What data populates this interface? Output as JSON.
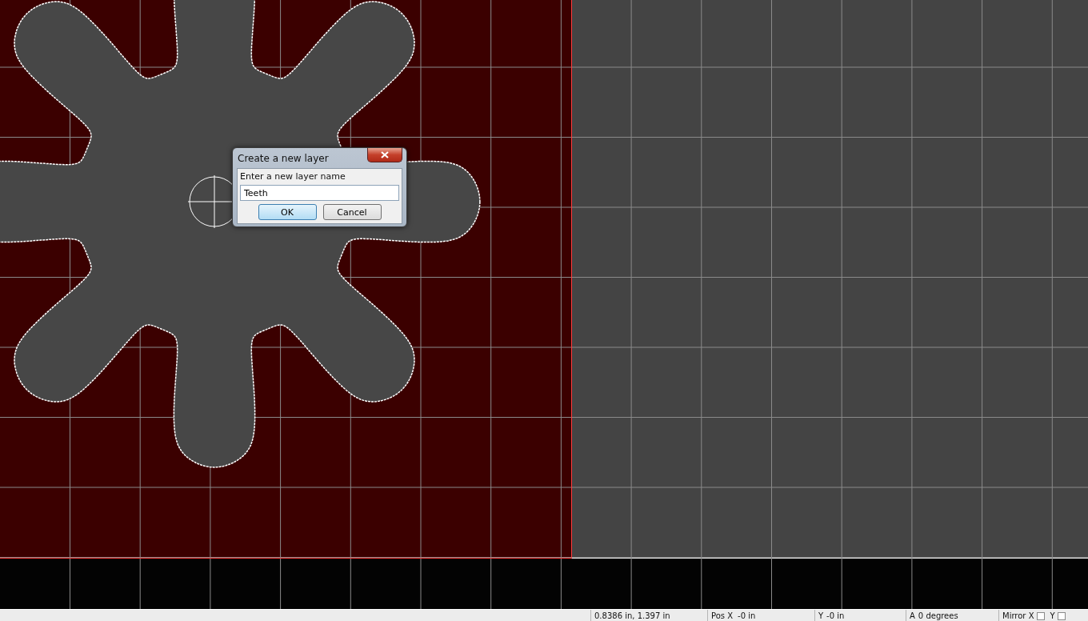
{
  "dialog": {
    "title": "Create a new layer",
    "prompt": "Enter a new layer name",
    "name_field": {
      "value": "Teeth"
    },
    "buttons": [
      {
        "label": "OK",
        "default": true
      },
      {
        "label": "Cancel",
        "default": false
      }
    ]
  },
  "status_bar": {
    "cursor": "0.8386 in, 1.397 in",
    "pos_x": {
      "label": "Pos X",
      "value": "-0 in"
    },
    "pos_y": {
      "label": "Y",
      "value": "-0 in"
    },
    "angle": {
      "label": "A",
      "value": "0 degrees"
    },
    "mirror_x": {
      "label": "Mirror X",
      "checked": false
    },
    "mirror_y": {
      "label": "Y",
      "checked": false
    }
  }
}
